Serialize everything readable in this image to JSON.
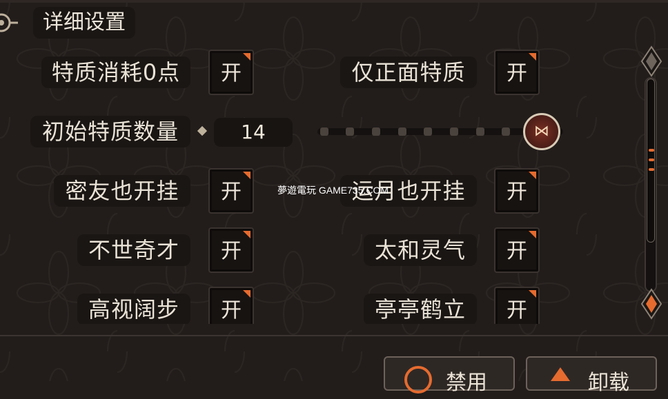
{
  "header": {
    "title": "详细设置",
    "icon": "gear-icon"
  },
  "settings": {
    "trait_cost_zero": {
      "label": "特质消耗0点",
      "value": "开"
    },
    "positive_only": {
      "label": "仅正面特质",
      "value": "开"
    },
    "initial_trait_count": {
      "label": "初始特质数量",
      "value": "14",
      "slider_fraction": 1.0
    },
    "confidant_cheat": {
      "label": "密友也开挂",
      "value": "开"
    },
    "luck_cheat_partial": {
      "label": "运月也开挂",
      "value": "开"
    },
    "unrivaled_talent": {
      "label": "不世奇才",
      "value": "开"
    },
    "taihe_spirit": {
      "label": "太和灵气",
      "value": "开"
    },
    "lofty_stride": {
      "label": "高视阔步",
      "value": "开"
    },
    "crane_stand": {
      "label": "亭亭鹤立",
      "value": "开"
    }
  },
  "watermark": "夢遊電玩 GAME735.COM",
  "footer": {
    "disable_label": "禁用",
    "uninstall_label": "卸载"
  },
  "colors": {
    "accent": "#e56b2f",
    "background": "#221d1b",
    "panel": "#1a1614",
    "text": "#e9e2d6"
  }
}
